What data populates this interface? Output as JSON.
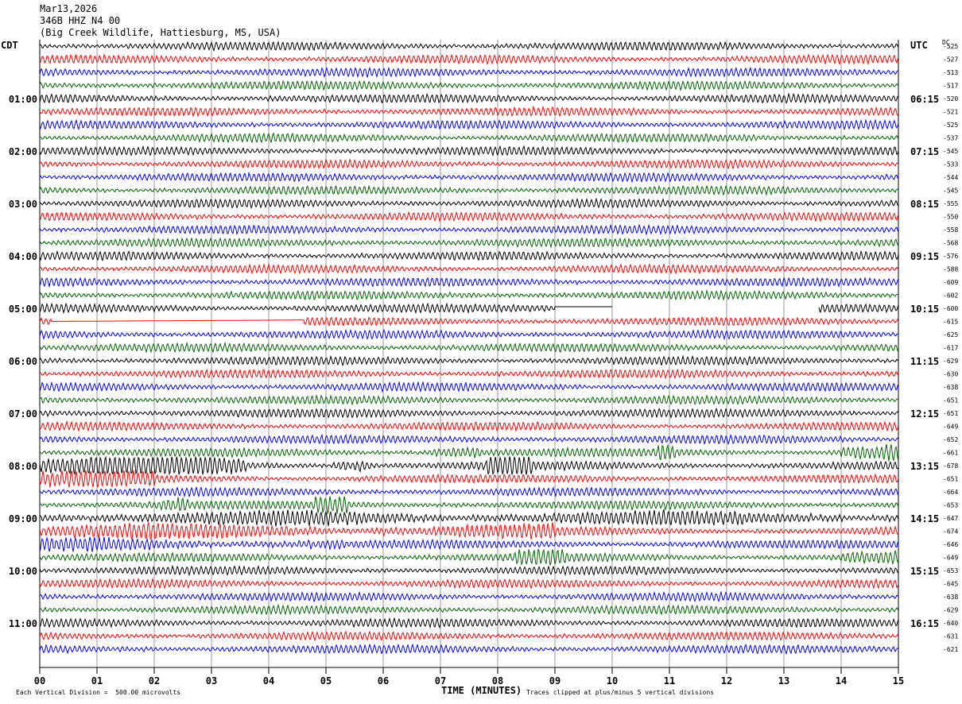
{
  "header": {
    "date": "Mar13,2026",
    "station": "346B HHZ N4 00",
    "location": "(Big Creek Wildlife, Hattiesburg, MS, USA)"
  },
  "left_zone_label": "CDT",
  "right_zone_label": "UTC",
  "dc_label": "DC",
  "footer": {
    "scale_note": "Each Vertical Division =  500.00 microvolts",
    "xlabel": "TIME (MINUTES)",
    "clip_note": "Traces clipped at plus/minus 5 vertical divisions"
  },
  "colors": [
    "#000000",
    "#ff0000",
    "#0000ff",
    "#006400"
  ],
  "chart_data": {
    "type": "line",
    "title": "346B HHZ N4 00",
    "xlabel": "TIME (MINUTES)",
    "x_ticks": [
      "00",
      "01",
      "02",
      "03",
      "04",
      "05",
      "06",
      "07",
      "08",
      "09",
      "10",
      "11",
      "12",
      "13",
      "14",
      "15"
    ],
    "xlim": [
      0,
      15
    ],
    "traces_per_hour": 4,
    "trace_minutes": 15,
    "left_hour_labels": [
      "01:00",
      "02:00",
      "03:00",
      "04:00",
      "05:00",
      "06:00",
      "07:00",
      "08:00",
      "09:00",
      "10:00",
      "11:00"
    ],
    "right_hour_labels": [
      "06:15",
      "07:15",
      "08:15",
      "09:15",
      "10:15",
      "11:15",
      "12:15",
      "13:15",
      "14:15",
      "15:15",
      "16:15"
    ],
    "dc_offsets": [
      -525,
      -527,
      -513,
      -517,
      -520,
      -521,
      -525,
      -537,
      -545,
      -533,
      -544,
      -545,
      -555,
      -550,
      -558,
      -568,
      -576,
      -588,
      -609,
      -602,
      -600,
      -615,
      -625,
      -617,
      -629,
      -630,
      -638,
      -651,
      -651,
      -649,
      -652,
      -661,
      -678,
      -651,
      -664,
      -653,
      -647,
      -674,
      -646,
      -649,
      -653,
      -645,
      -638,
      -629,
      -640,
      -631,
      -621
    ],
    "gaps": [
      {
        "trace": 20,
        "from_min": 9.0,
        "to_min": 10.0
      },
      {
        "trace": 20,
        "from_min": 10.0,
        "to_min": 13.6
      },
      {
        "trace": 21,
        "from_min": 0.2,
        "to_min": 4.6
      }
    ],
    "bursts": [
      {
        "trace": 31,
        "from_min": 6.8,
        "to_min": 7.7,
        "level": 2.2
      },
      {
        "trace": 31,
        "from_min": 14.0,
        "to_min": 15.0,
        "level": 2.4
      },
      {
        "trace": 31,
        "from_min": 10.8,
        "to_min": 11.1,
        "level": 2.0
      },
      {
        "trace": 32,
        "from_min": 0.0,
        "to_min": 3.6,
        "level": 2.6
      },
      {
        "trace": 32,
        "from_min": 5.1,
        "to_min": 5.8,
        "level": 2.8
      },
      {
        "trace": 32,
        "from_min": 7.8,
        "to_min": 8.6,
        "level": 3.0
      },
      {
        "trace": 33,
        "from_min": 0.0,
        "to_min": 2.0,
        "level": 1.9
      },
      {
        "trace": 35,
        "from_min": 4.8,
        "to_min": 5.4,
        "level": 2.6
      },
      {
        "trace": 35,
        "from_min": 2.1,
        "to_min": 2.6,
        "level": 1.8
      },
      {
        "trace": 36,
        "from_min": 0.0,
        "to_min": 15.0,
        "level": 1.7
      },
      {
        "trace": 37,
        "from_min": 0.0,
        "to_min": 9.0,
        "level": 1.8
      },
      {
        "trace": 38,
        "from_min": 0.0,
        "to_min": 5.3,
        "level": 1.6
      },
      {
        "trace": 39,
        "from_min": 8.3,
        "to_min": 9.2,
        "level": 1.8
      },
      {
        "trace": 39,
        "from_min": 14.0,
        "to_min": 15.0,
        "level": 1.6
      }
    ]
  }
}
